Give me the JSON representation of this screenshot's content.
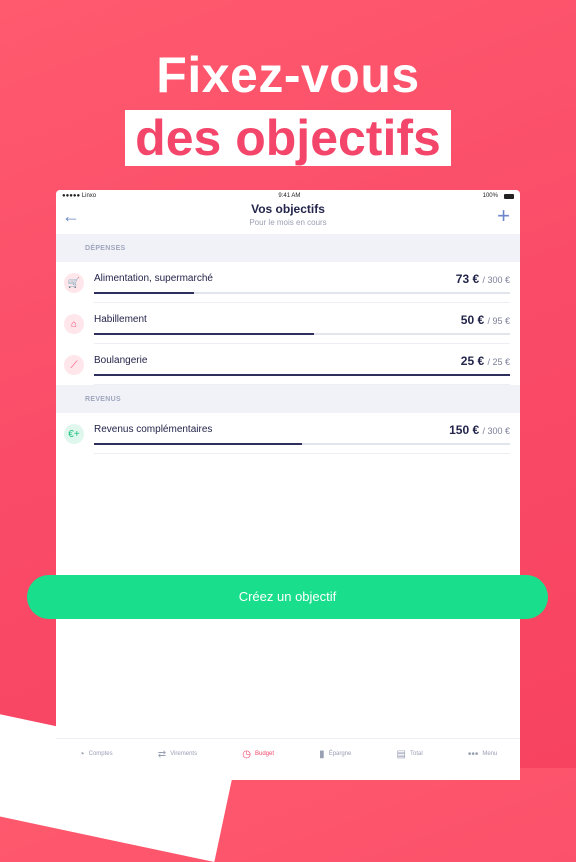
{
  "headline": {
    "line1": "Fixez-vous",
    "line2": "des objectifs"
  },
  "status": {
    "carrier": "●●●●● Linxo",
    "time": "9:41 AM",
    "battery": "100%"
  },
  "nav": {
    "back_icon": "←",
    "title": "Vos objectifs",
    "subtitle": "Pour le mois en cours",
    "add_icon": "+"
  },
  "sections": {
    "expenses": "DÉPENSES",
    "income": "REVENUS"
  },
  "expenses": [
    {
      "label": "Alimentation, supermarché",
      "amount": "73 €",
      "target": "/ 300 €",
      "progress": 0.24,
      "icon": "cart-icon",
      "glyph": "🛒",
      "color": "#f4466a"
    },
    {
      "label": "Habillement",
      "amount": "50 €",
      "target": "/ 95 €",
      "progress": 0.53,
      "icon": "hanger-icon",
      "glyph": "⌂",
      "color": "#f4466a"
    },
    {
      "label": "Boulangerie",
      "amount": "25 €",
      "target": "/ 25 €",
      "progress": 1.0,
      "icon": "baguette-icon",
      "glyph": "⟋",
      "color": "#f4466a"
    }
  ],
  "income": [
    {
      "label": "Revenus complémentaires",
      "amount": "150 €",
      "target": "/ 300 €",
      "progress": 0.5,
      "icon": "euro-plus-icon",
      "glyph": "€+",
      "color": "#19c27d"
    }
  ],
  "cta": {
    "label": "Créez un objectif"
  },
  "tabs": [
    {
      "label": "Comptes",
      "icon": "pie-icon",
      "glyph": "◔",
      "active": false
    },
    {
      "label": "Virements",
      "icon": "transfer-icon",
      "glyph": "⇄",
      "active": false
    },
    {
      "label": "Budget",
      "icon": "budget-icon",
      "glyph": "◷",
      "active": true
    },
    {
      "label": "Épargne",
      "icon": "bars-icon",
      "glyph": "▮",
      "active": false
    },
    {
      "label": "Total",
      "icon": "total-icon",
      "glyph": "▤",
      "active": false
    },
    {
      "label": "Menu",
      "icon": "menu-icon",
      "glyph": "•••",
      "active": false
    }
  ]
}
